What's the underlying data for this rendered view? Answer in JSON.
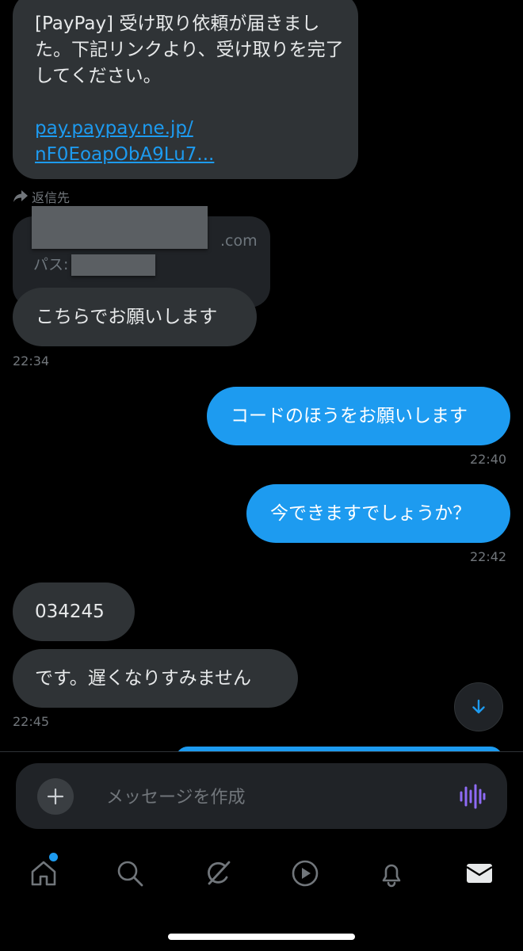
{
  "messages": {
    "m1": {
      "text": "[PayPay] 受け取り依頼が届きました。下記リンクより、受け取りを完了してください。",
      "link_line1": "pay.paypay.ne.jp/",
      "link_line2": "nF0EoapObA9Lu7..."
    },
    "reply_label": "返信先",
    "quoted": {
      "domain_suffix": ".com",
      "pass_label": "パス:"
    },
    "m2": {
      "text": "こちらでお願いします",
      "time": "22:34"
    },
    "m3": {
      "text": "コードのほうをお願いします",
      "time": "22:40"
    },
    "m4": {
      "text": "今できますでしょうか？",
      "time": "22:42"
    },
    "m5": {
      "text": "034245"
    },
    "m6": {
      "text": "です。遅くなりすみません",
      "time": "22:45"
    }
  },
  "composer": {
    "placeholder": "メッセージを作成"
  },
  "icons": {
    "reply": "reply-arrow-icon",
    "scroll": "arrow-down-icon",
    "plus": "plus-icon",
    "voice": "voice-wave-icon",
    "tabs": [
      "home-icon",
      "search-icon",
      "grok-icon",
      "video-icon",
      "bell-icon",
      "mail-icon"
    ]
  },
  "colors": {
    "accent": "#1d9bf0",
    "bubble_in": "#2f3336",
    "voice": "#8e6bf5"
  }
}
